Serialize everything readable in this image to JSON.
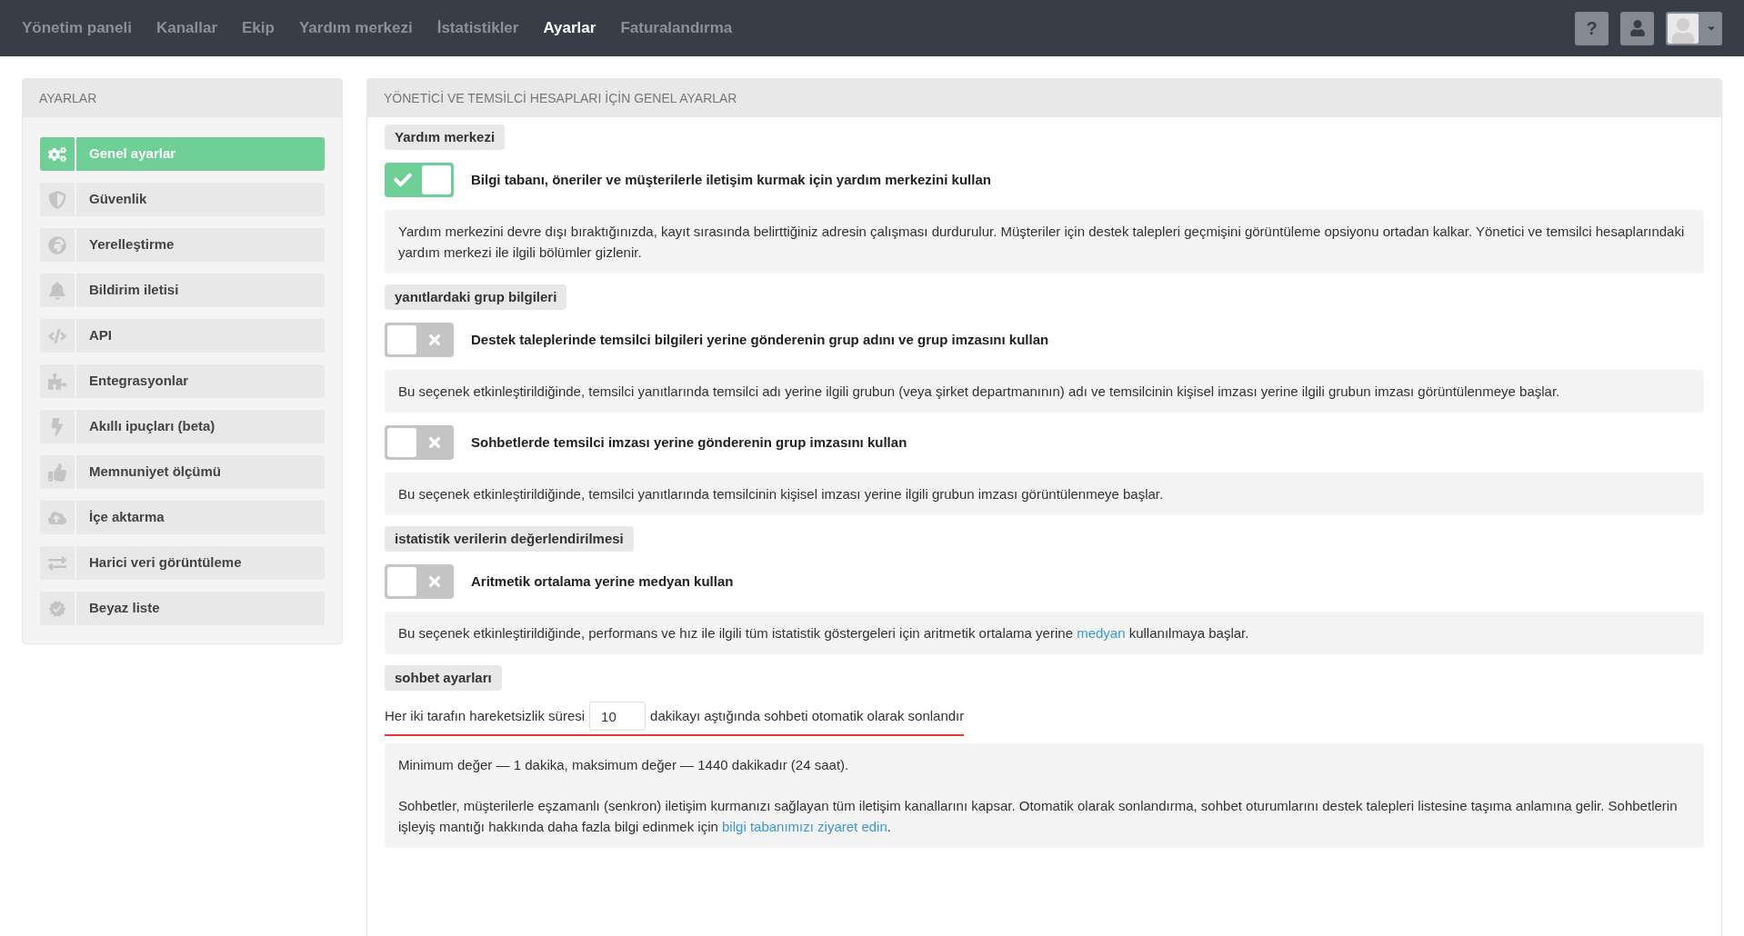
{
  "nav": {
    "items": [
      {
        "label": "Yönetim paneli",
        "selected": false
      },
      {
        "label": "Kanallar",
        "selected": false
      },
      {
        "label": "Ekip",
        "selected": false
      },
      {
        "label": "Yardım merkezi",
        "selected": false
      },
      {
        "label": "İstatistikler",
        "selected": false
      },
      {
        "label": "Ayarlar",
        "selected": true
      },
      {
        "label": "Faturalandırma",
        "selected": false
      }
    ],
    "help_label": "?"
  },
  "sidebar": {
    "title": "AYARLAR",
    "items": [
      {
        "label": "Genel ayarlar",
        "selected": true
      },
      {
        "label": "Güvenlik",
        "selected": false
      },
      {
        "label": "Yerelleştirme",
        "selected": false
      },
      {
        "label": "Bildirim iletisi",
        "selected": false
      },
      {
        "label": "API",
        "selected": false
      },
      {
        "label": "Entegrasyonlar",
        "selected": false
      },
      {
        "label": "Akıllı ipuçları (beta)",
        "selected": false
      },
      {
        "label": "Memnuniyet ölçümü",
        "selected": false
      },
      {
        "label": "İçe aktarma",
        "selected": false
      },
      {
        "label": "Harici veri görüntüleme",
        "selected": false
      },
      {
        "label": "Beyaz liste",
        "selected": false
      }
    ]
  },
  "main": {
    "title": "YÖNETİCİ VE TEMSİLCİ HESAPLARI İÇİN GENEL AYARLAR",
    "sections": [
      {
        "heading": "Yardım merkezi",
        "blocks": [
          {
            "kind": "toggle",
            "label": "Bilgi tabanı, öneriler ve müşterilerle iletişim kurmak için yardım merkezini kullan",
            "on": true
          },
          {
            "kind": "note",
            "paragraphs": [
              [
                {
                  "kind": "text",
                  "text": "Yardım merkezini devre dışı bıraktığınızda, kayıt sırasında belirttiğiniz adresin çalışması durdurulur. Müşteriler için destek talepleri geçmişini görüntüleme opsiyonu ortadan kalkar. Yönetici ve temsilci hesaplarındaki yardım merkezi ile ilgili bölümler gizlenir."
                }
              ]
            ]
          }
        ]
      },
      {
        "heading": "yanıtlardaki grup bilgileri",
        "blocks": [
          {
            "kind": "toggle",
            "label": "Destek taleplerinde temsilci bilgileri yerine gönderenin grup adını ve grup imzasını kullan",
            "on": false
          },
          {
            "kind": "note",
            "paragraphs": [
              [
                {
                  "kind": "text",
                  "text": "Bu seçenek etkinleştirildiğinde, temsilci yanıtlarında temsilci adı yerine ilgili grubun (veya şirket departmanının) adı ve temsilcinin kişisel imzası yerine ilgili grubun imzası görüntülenmeye başlar."
                }
              ]
            ]
          },
          {
            "kind": "toggle",
            "label": "Sohbetlerde temsilci imzası yerine gönderenin grup imzasını kullan",
            "on": false
          },
          {
            "kind": "note",
            "paragraphs": [
              [
                {
                  "kind": "text",
                  "text": "Bu seçenek etkinleştirildiğinde, temsilci yanıtlarında temsilcinin kişisel imzası yerine ilgili grubun imzası görüntülenmeye başlar."
                }
              ]
            ]
          }
        ]
      },
      {
        "heading": "istatistik verilerin değerlendirilmesi",
        "blocks": [
          {
            "kind": "toggle",
            "label": "Aritmetik ortalama yerine medyan kullan",
            "on": false
          },
          {
            "kind": "note",
            "paragraphs": [
              [
                {
                  "kind": "text",
                  "text": "Bu seçenek etkinleştirildiğinde, performans ve hız ile ilgili tüm istatistik göstergeleri için aritmetik ortalama yerine "
                },
                {
                  "kind": "link",
                  "text": "medyan"
                },
                {
                  "kind": "text",
                  "text": " kullanılmaya başlar."
                }
              ]
            ]
          }
        ]
      },
      {
        "heading": "sohbet ayarları",
        "blocks": [
          {
            "kind": "inline_field",
            "before": "Her iki tarafın hareketsizlik süresi",
            "value": "10",
            "after": "dakikayı aştığında sohbeti otomatik olarak sonlandır",
            "error": true
          },
          {
            "kind": "note",
            "paragraphs": [
              [
                {
                  "kind": "text",
                  "text": "Minimum değer — 1 dakika, maksimum değer — 1440 dakikadır (24 saat)."
                }
              ],
              [
                {
                  "kind": "text",
                  "text": "Sohbetler, müşterilerle eşzamanlı (senkron) iletişim kurmanızı sağlayan tüm iletişim kanallarını kapsar. Otomatik olarak sonlandırma, sohbet oturumlarını destek talepleri listesine taşıma anlamına gelir. Sohbetlerin işleyiş mantığı hakkında daha fazla bilgi edinmek için "
                },
                {
                  "kind": "link",
                  "text": "bilgi tabanımızı ziyaret edin"
                },
                {
                  "kind": "text",
                  "text": "."
                }
              ]
            ]
          }
        ]
      }
    ]
  }
}
